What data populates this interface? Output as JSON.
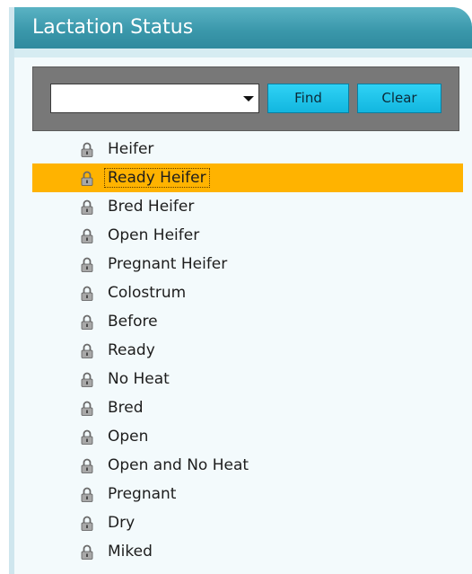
{
  "panel": {
    "title": "Lactation Status"
  },
  "search": {
    "combo_value": "",
    "find_label": "Find",
    "clear_label": "Clear"
  },
  "status_list": {
    "selected_index": 1,
    "items": [
      {
        "label": "Heifer",
        "icon": "lock-icon"
      },
      {
        "label": "Ready Heifer",
        "icon": "lock-icon"
      },
      {
        "label": "Bred Heifer",
        "icon": "lock-icon"
      },
      {
        "label": "Open Heifer",
        "icon": "lock-icon"
      },
      {
        "label": "Pregnant Heifer",
        "icon": "lock-icon"
      },
      {
        "label": "Colostrum",
        "icon": "lock-icon"
      },
      {
        "label": "Before",
        "icon": "lock-icon"
      },
      {
        "label": "Ready",
        "icon": "lock-icon"
      },
      {
        "label": "No Heat",
        "icon": "lock-icon"
      },
      {
        "label": "Bred",
        "icon": "lock-icon"
      },
      {
        "label": "Open",
        "icon": "lock-icon"
      },
      {
        "label": "Open and No Heat",
        "icon": "lock-icon"
      },
      {
        "label": "Pregnant",
        "icon": "lock-icon"
      },
      {
        "label": "Dry",
        "icon": "lock-icon"
      },
      {
        "label": "Miked",
        "icon": "lock-icon"
      }
    ]
  },
  "colors": {
    "header": "#3b98ab",
    "selection": "#ffb300",
    "button": "#12b6df",
    "search_bar": "#787878"
  }
}
